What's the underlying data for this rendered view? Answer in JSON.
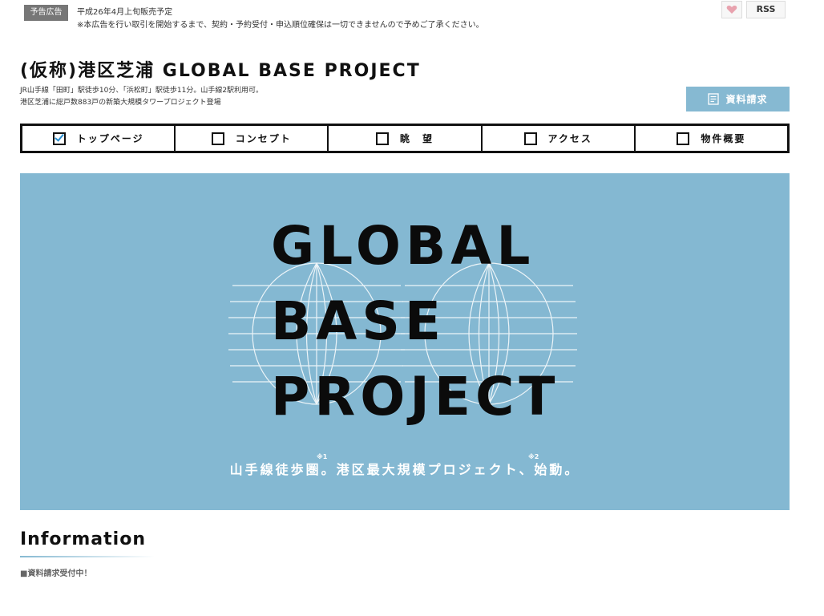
{
  "notice": {
    "badge": "予告広告",
    "line1": "平成26年4月上旬販売予定",
    "line2": "※本広告を行い取引を開始するまで、契約・予約受付・申込順位確保は一切できませんので予めご了承ください。"
  },
  "header": {
    "rss_label": "RSS",
    "heart_icon": "heart-icon",
    "title": "(仮称)港区芝浦 GLOBAL BASE PROJECT",
    "desc1": "JR山手線「田町」駅徒歩10分、「浜松町」駅徒歩11分。山手線2駅利用可。",
    "desc2": "港区芝浦に総戸数883戸の新築大規模タワープロジェクト登場",
    "request_label": "資料請求"
  },
  "nav": {
    "items": [
      {
        "label": "トップページ",
        "checked": true
      },
      {
        "label": "コンセプト",
        "checked": false
      },
      {
        "label": "眺　望",
        "checked": false
      },
      {
        "label": "アクセス",
        "checked": false
      },
      {
        "label": "物件概要",
        "checked": false
      }
    ]
  },
  "hero": {
    "line1": "GLOBAL",
    "line2": "BASE",
    "line3": "PROJECT",
    "caption": "山手線徒歩圏。港区最大規模プロジェクト、始動。",
    "note1": "※1",
    "note2": "※2",
    "bg_color": "#84b8d2"
  },
  "info": {
    "title": "Information",
    "item": "■資料請求受付中！"
  }
}
